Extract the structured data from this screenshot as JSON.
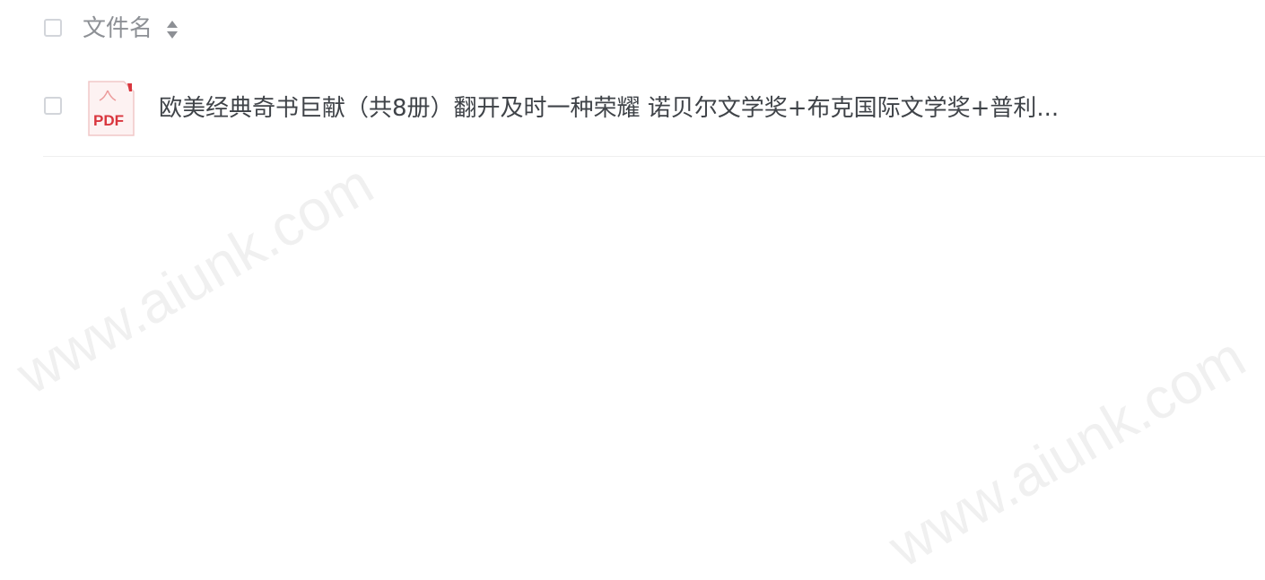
{
  "header": {
    "column_label": "文件名"
  },
  "files": [
    {
      "type": "PDF",
      "name": "欧美经典奇书巨献（共8册）翻开及时一种荣耀 诺贝尔文学奖+布克国际文学奖+普利..."
    }
  ],
  "watermark": "www.aiunk.com",
  "icons": {
    "header_checkbox": "checkbox-icon",
    "sort": "sort-icon",
    "file_type": "pdf-file-icon"
  },
  "colors": {
    "text_primary": "#3f4348",
    "text_secondary": "#8d9095",
    "pdf_red": "#d9363e",
    "border": "#d2d5da"
  }
}
